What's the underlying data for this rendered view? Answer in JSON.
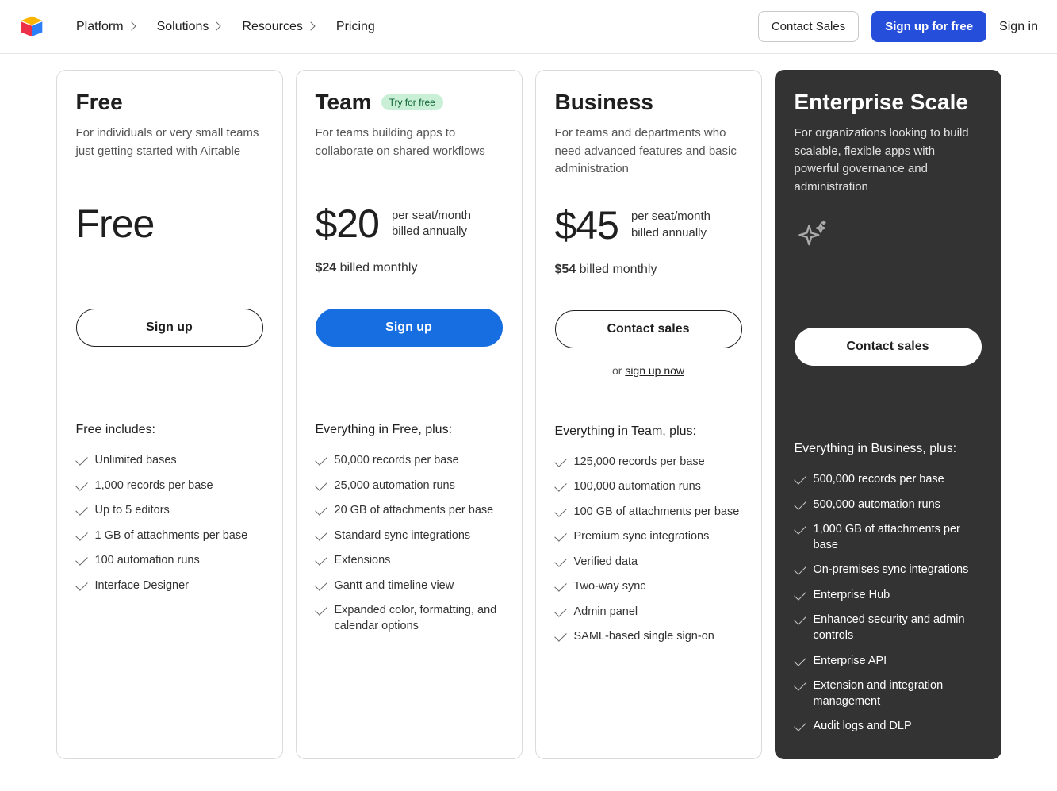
{
  "nav": {
    "items": [
      {
        "label": "Platform",
        "has_dropdown": true
      },
      {
        "label": "Solutions",
        "has_dropdown": true
      },
      {
        "label": "Resources",
        "has_dropdown": true
      },
      {
        "label": "Pricing",
        "has_dropdown": false
      }
    ],
    "contact_sales": "Contact Sales",
    "sign_up_free": "Sign up for free",
    "sign_in": "Sign in"
  },
  "plans": [
    {
      "name": "Free",
      "badge": null,
      "desc": "For individuals or very small teams just getting started with Airtable",
      "price_amount": "Free",
      "price_note": "",
      "monthly_price": "",
      "monthly_label": "",
      "cta_label": "Sign up",
      "cta_style": "outline",
      "sub_cta_prefix": "",
      "sub_cta_link": "",
      "includes_title": "Free includes:",
      "features": [
        "Unlimited bases",
        "1,000 records per base",
        "Up to 5 editors",
        "1 GB of attachments per base",
        "100 automation runs",
        "Interface Designer"
      ]
    },
    {
      "name": "Team",
      "badge": "Try for free",
      "desc": "For teams building apps to collaborate on shared workflows",
      "price_amount": "$20",
      "price_note": "per seat/month\nbilled annually",
      "monthly_price": "$24",
      "monthly_label": " billed monthly",
      "cta_label": "Sign up",
      "cta_style": "blue",
      "sub_cta_prefix": "",
      "sub_cta_link": "",
      "includes_title": "Everything in Free, plus:",
      "features": [
        "50,000 records per base",
        "25,000 automation runs",
        "20 GB of attachments per base",
        "Standard sync integrations",
        "Extensions",
        "Gantt and timeline view",
        "Expanded color, formatting, and calendar options"
      ]
    },
    {
      "name": "Business",
      "badge": null,
      "desc": "For teams and departments who need advanced features and basic administration",
      "price_amount": "$45",
      "price_note": "per seat/month\nbilled annually",
      "monthly_price": "$54",
      "monthly_label": " billed monthly",
      "cta_label": "Contact sales",
      "cta_style": "outline",
      "sub_cta_prefix": "or ",
      "sub_cta_link": "sign up now",
      "includes_title": "Everything in Team, plus:",
      "features": [
        "125,000 records per base",
        "100,000 automation runs",
        "100 GB of attachments per base",
        "Premium sync integrations",
        "Verified data",
        "Two-way sync",
        "Admin panel",
        "SAML-based single sign-on"
      ]
    },
    {
      "name": "Enterprise Scale",
      "badge": null,
      "desc": "For organizations looking to build scalable, flexible apps with powerful governance and administration",
      "price_amount": "",
      "price_note": "",
      "monthly_price": "",
      "monthly_label": "",
      "cta_label": "Contact sales",
      "cta_style": "white",
      "sub_cta_prefix": "",
      "sub_cta_link": "",
      "includes_title": "Everything in Business, plus:",
      "features": [
        "500,000 records per base",
        "500,000 automation runs",
        "1,000 GB of attachments per base",
        "On-premises sync integrations",
        "Enterprise Hub",
        "Enhanced security and admin controls",
        "Enterprise API",
        "Extension and integration management",
        "Audit logs and DLP"
      ]
    }
  ]
}
